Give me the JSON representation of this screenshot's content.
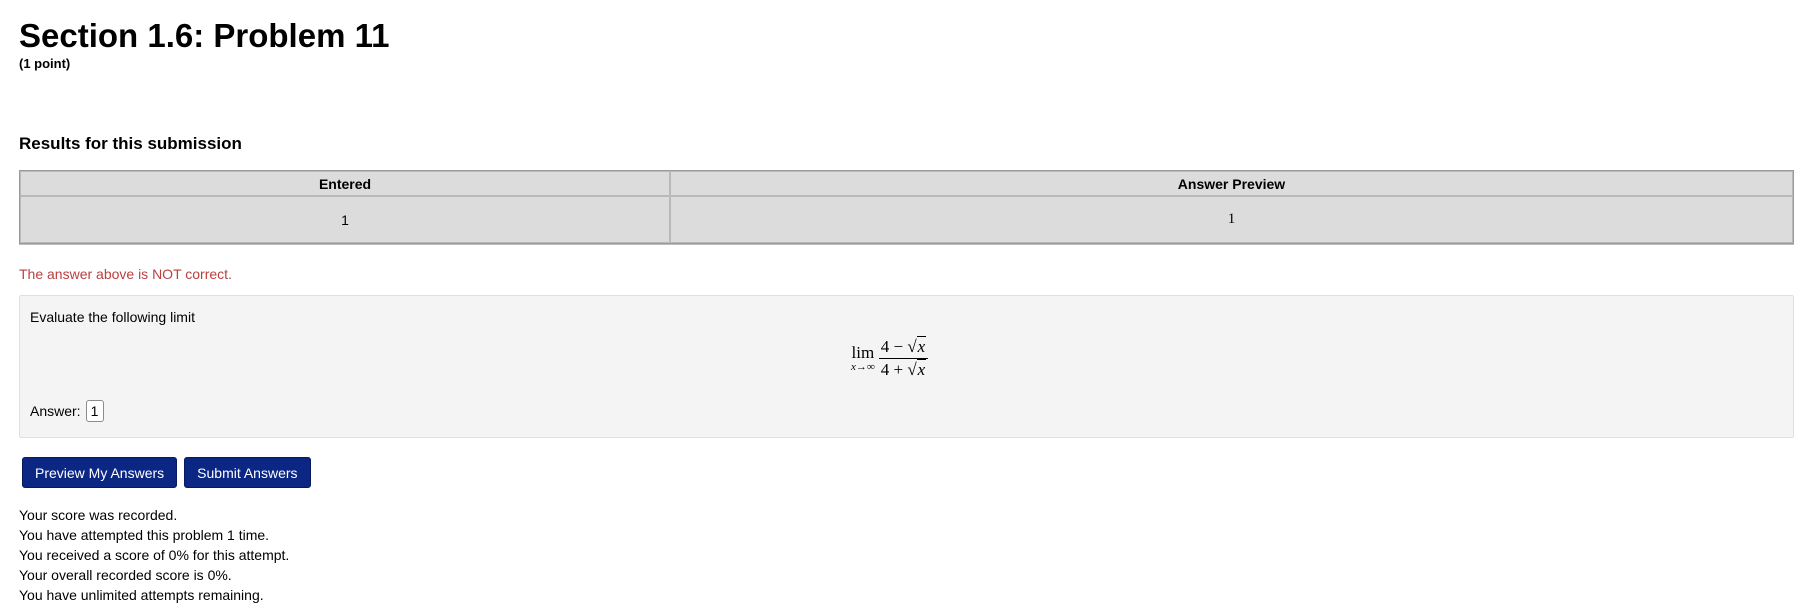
{
  "problem": {
    "title": "Section 1.6: Problem 11",
    "points": "(1 point)"
  },
  "results": {
    "heading": "Results for this submission",
    "columns": [
      "Entered",
      "Answer Preview"
    ],
    "rows": [
      {
        "entered": "1",
        "preview": "1"
      }
    ],
    "feedback": "The answer above is NOT correct.",
    "feedback_color": "#b9403f"
  },
  "question": {
    "prompt": "Evaluate the following limit",
    "math": {
      "operator": "lim",
      "subscript": "x→∞",
      "numerator_prefix": "4 − ",
      "denominator_prefix": "4 + ",
      "radicand": "x"
    },
    "answer_label": "Answer:",
    "answer_value": "1"
  },
  "buttons": {
    "preview": "Preview My Answers",
    "submit": "Submit Answers",
    "color": "#0c2684"
  },
  "status_lines": [
    "Your score was recorded.",
    "You have attempted this problem 1 time.",
    "You received a score of 0% for this attempt.",
    "Your overall recorded score is 0%.",
    "You have unlimited attempts remaining."
  ]
}
